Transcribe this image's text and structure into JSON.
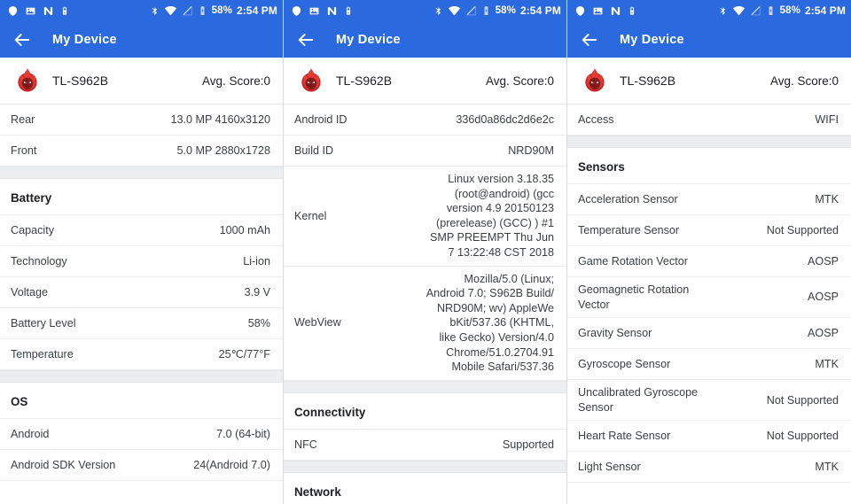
{
  "statusbar": {
    "icons_left": [
      "blob-icon",
      "photo-icon",
      "nougat-n-icon",
      "device-icon"
    ],
    "icons_right": [
      "bluetooth-icon",
      "wifi-icon",
      "no-signal-icon",
      "battery-charging-icon"
    ],
    "battery_percent": "58%",
    "time": "2:54 PM"
  },
  "appbar": {
    "back_icon": "back-arrow-icon",
    "title": "My Device"
  },
  "device": {
    "logo_icon": "antutu-flame-logo",
    "name": "TL-S962B",
    "avg_score": "Avg. Score:0"
  },
  "colors": {
    "accent_blue": "#2a6ade",
    "separator_gray": "#eceef0",
    "logo_red": "#d32f2f"
  },
  "panels": [
    {
      "id": "panel-camera-battery-os",
      "blocks": [
        {
          "type": "row",
          "key": "Rear",
          "value": "13.0 MP 4160x3120"
        },
        {
          "type": "row",
          "key": "Front",
          "value": "5.0 MP 2880x1728"
        },
        {
          "type": "gap"
        },
        {
          "type": "section",
          "title": "Battery"
        },
        {
          "type": "row",
          "key": "Capacity",
          "value": "1000 mAh"
        },
        {
          "type": "row",
          "key": "Technology",
          "value": "Li-ion"
        },
        {
          "type": "row",
          "key": "Voltage",
          "value": "3.9 V"
        },
        {
          "type": "row",
          "key": "Battery Level",
          "value": "58%"
        },
        {
          "type": "row",
          "key": "Temperature",
          "value": "25℃/77°F"
        },
        {
          "type": "gap"
        },
        {
          "type": "section",
          "title": "OS"
        },
        {
          "type": "row",
          "key": "Android",
          "value": "7.0 (64-bit)"
        },
        {
          "type": "row",
          "key": "Android SDK Version",
          "value": "24(Android 7.0)"
        }
      ]
    },
    {
      "id": "panel-system-connectivity",
      "blocks": [
        {
          "type": "row",
          "key": "Android ID",
          "value": "336d0a86dc2d6e2c"
        },
        {
          "type": "row",
          "key": "Build ID",
          "value": "NRD90M"
        },
        {
          "type": "row",
          "tall": true,
          "key": "Kernel",
          "value": "Linux version 3.18.35\n(root@android) (gcc\nversion 4.9 20150123\n(prerelease) (GCC) ) #1\nSMP PREEMPT Thu Jun\n7 13:22:48 CST 2018"
        },
        {
          "type": "row",
          "tall": true,
          "key": "WebView",
          "value": "Mozilla/5.0 (Linux;\nAndroid 7.0; S962B Build/\nNRD90M; wv) AppleWe\nbKit/537.36 (KHTML,\nlike Gecko) Version/4.0\nChrome/51.0.2704.91\nMobile Safari/537.36"
        },
        {
          "type": "gap"
        },
        {
          "type": "section",
          "title": "Connectivity"
        },
        {
          "type": "row",
          "key": "NFC",
          "value": "Supported"
        },
        {
          "type": "gap"
        },
        {
          "type": "section",
          "title": "Network"
        }
      ]
    },
    {
      "id": "panel-sensors",
      "blocks": [
        {
          "type": "row",
          "key": "Access",
          "value": "WIFI"
        },
        {
          "type": "gap"
        },
        {
          "type": "section",
          "title": "Sensors"
        },
        {
          "type": "row",
          "key": "Acceleration Sensor",
          "value": "MTK"
        },
        {
          "type": "row",
          "key": "Temperature Sensor",
          "value": "Not Supported"
        },
        {
          "type": "row",
          "key": "Game Rotation Vector",
          "value": "AOSP"
        },
        {
          "type": "row",
          "key": "Geomagnetic Rotation Vector",
          "value": "AOSP"
        },
        {
          "type": "row",
          "key": "Gravity Sensor",
          "value": "AOSP"
        },
        {
          "type": "row",
          "key": "Gyroscope Sensor",
          "value": "MTK"
        },
        {
          "type": "row",
          "key": "Uncalibrated Gyroscope Sensor",
          "value": "Not Supported"
        },
        {
          "type": "row",
          "key": "Heart Rate Sensor",
          "value": "Not Supported"
        },
        {
          "type": "row",
          "key": "Light Sensor",
          "value": "MTK"
        }
      ]
    }
  ]
}
